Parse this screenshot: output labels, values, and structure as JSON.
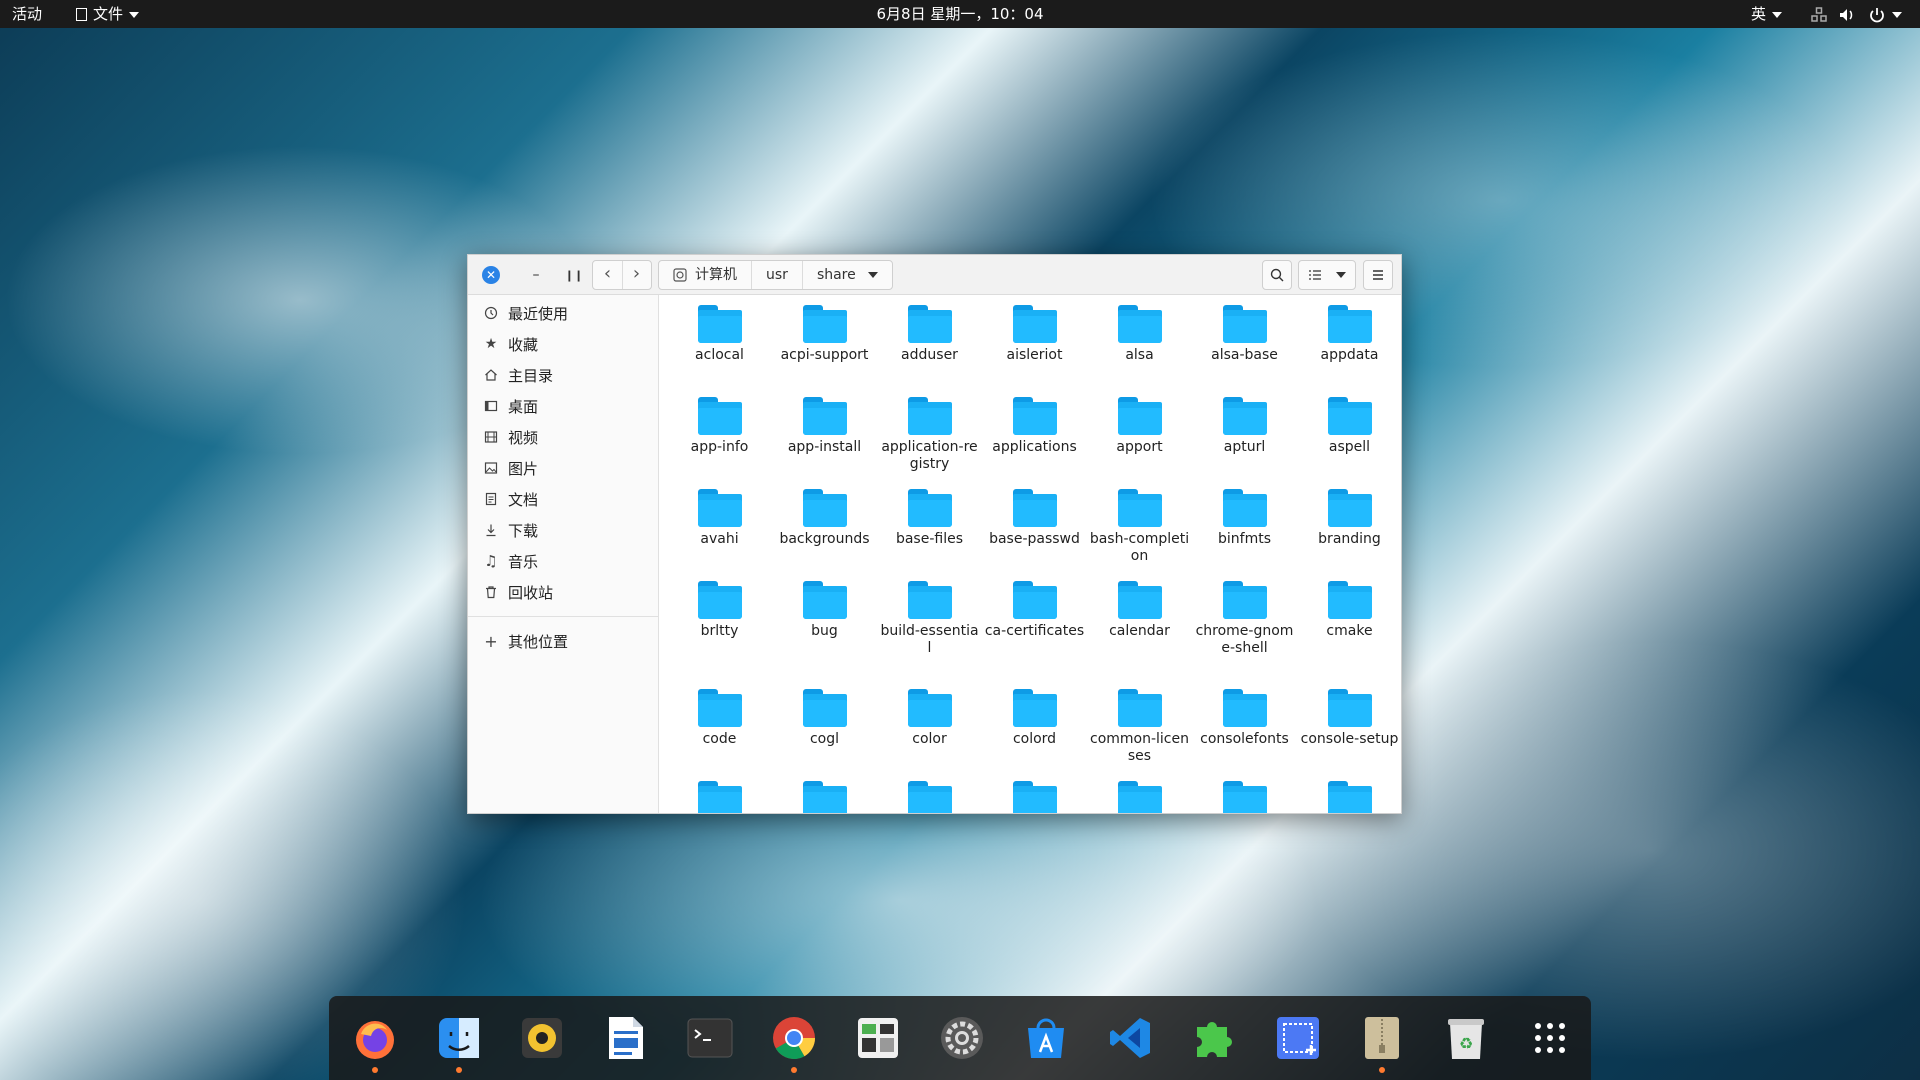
{
  "topbar": {
    "activities": "活动",
    "app_menu": "文件",
    "clock": "6月8日 星期一，10：04",
    "input_method": "英"
  },
  "window": {
    "breadcrumbs": [
      "计算机",
      "usr",
      "share"
    ]
  },
  "sidebar": {
    "items": [
      "最近使用",
      "收藏",
      "主目录",
      "桌面",
      "视频",
      "图片",
      "文档",
      "下载",
      "音乐",
      "回收站"
    ],
    "other_locations": "其他位置"
  },
  "folders": [
    "aclocal",
    "acpi-support",
    "adduser",
    "aisleriot",
    "alsa",
    "alsa-base",
    "appdata",
    "app-info",
    "app-install",
    "application-registry",
    "applications",
    "apport",
    "apturl",
    "aspell",
    "avahi",
    "backgrounds",
    "base-files",
    "base-passwd",
    "bash-completion",
    "binfmts",
    "branding",
    "brltty",
    "bug",
    "build-essential",
    "ca-certificates",
    "calendar",
    "chrome-gnome-shell",
    "cmake",
    "code",
    "cogl",
    "color",
    "colord",
    "common-licenses",
    "consolefonts",
    "console-setup",
    "",
    "",
    "",
    "",
    "",
    "",
    ""
  ],
  "dock": {
    "items": [
      "firefox-icon",
      "finder-icon",
      "music-player-icon",
      "text-editor-icon",
      "terminal-icon",
      "chrome-icon",
      "system-monitor-icon",
      "settings-icon",
      "app-store-icon",
      "vscode-icon",
      "extensions-icon",
      "screenshot-icon",
      "archive-icon",
      "trash-icon",
      "app-grid-icon"
    ],
    "running": [
      "firefox-icon",
      "finder-icon",
      "chrome-icon",
      "archive-icon"
    ]
  },
  "colors": {
    "accent": "#2a83e6",
    "folder": "#1ab0f5",
    "running_dot": "#ff7a2f"
  }
}
